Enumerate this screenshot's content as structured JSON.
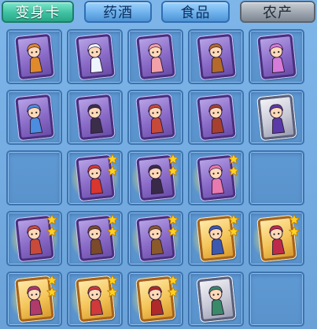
{
  "tabs": [
    {
      "label": "变身卡",
      "state": "active"
    },
    {
      "label": "药酒",
      "state": "inactive"
    },
    {
      "label": "食品",
      "state": "inactive"
    },
    {
      "label": "农产",
      "state": "gray"
    }
  ],
  "colors": {
    "background": "#6fa6dc",
    "slot": "#5a93cc",
    "card_purple": "#8a6bc8",
    "card_gold": "#f4c55a",
    "card_silver": "#c8c9d6",
    "star": "#ffd21f"
  },
  "grid": {
    "columns": 5,
    "rows": 5,
    "slots": [
      {
        "card": "purple",
        "icon": "monkey-king-card-icon",
        "stars": 0,
        "glow": false,
        "figure": "#e08a2a"
      },
      {
        "card": "purple",
        "icon": "white-horse-card-icon",
        "stars": 0,
        "glow": false,
        "figure": "#eef4ff"
      },
      {
        "card": "purple",
        "icon": "pig-card-icon",
        "stars": 0,
        "glow": false,
        "figure": "#f3a0a8"
      },
      {
        "card": "purple",
        "icon": "monk-card-icon",
        "stars": 0,
        "glow": false,
        "figure": "#b36a2a"
      },
      {
        "card": "purple",
        "icon": "fairy-fox-card-icon",
        "stars": 0,
        "glow": false,
        "figure": "#d67bd8"
      },
      {
        "card": "purple",
        "icon": "blue-beast-card-icon",
        "stars": 0,
        "glow": false,
        "figure": "#4b8de0"
      },
      {
        "card": "purple",
        "icon": "dark-warrior-card-icon",
        "stars": 0,
        "glow": false,
        "figure": "#3a2e4a"
      },
      {
        "card": "purple",
        "icon": "red-demon-card-icon",
        "stars": 0,
        "glow": false,
        "figure": "#c6493a"
      },
      {
        "card": "purple",
        "icon": "armored-demon-card-icon",
        "stars": 0,
        "glow": false,
        "figure": "#a8402f"
      },
      {
        "card": "silver",
        "icon": "purple-knight-card-icon",
        "stars": 0,
        "glow": false,
        "figure": "#5a3aa8"
      },
      {
        "card": null,
        "icon": "",
        "stars": 0,
        "glow": false,
        "figure": ""
      },
      {
        "card": "purple",
        "icon": "red-phoenix-card-icon",
        "stars": 2,
        "glow": true,
        "figure": "#d8362e"
      },
      {
        "card": "purple",
        "icon": "dark-maiden-card-icon",
        "stars": 2,
        "glow": true,
        "figure": "#3a2a4a"
      },
      {
        "card": "purple",
        "icon": "pink-maiden-card-icon",
        "stars": 2,
        "glow": true,
        "figure": "#e87ab0"
      },
      {
        "card": null,
        "icon": "",
        "stars": 0,
        "glow": false,
        "figure": ""
      },
      {
        "card": "purple",
        "icon": "red-ogre-card-icon",
        "stars": 2,
        "glow": true,
        "figure": "#c84a3a"
      },
      {
        "card": "purple",
        "icon": "horned-king-card-icon",
        "stars": 2,
        "glow": true,
        "figure": "#7a4a2a"
      },
      {
        "card": "purple",
        "icon": "gold-warrior-card-icon",
        "stars": 2,
        "glow": true,
        "figure": "#8a5a2a"
      },
      {
        "card": "gold",
        "icon": "fairy-princess-card-icon",
        "stars": 2,
        "glow": true,
        "figure": "#3a5ab0"
      },
      {
        "card": "gold",
        "icon": "wing-fairy-card-icon",
        "stars": 2,
        "glow": true,
        "figure": "#c02a4a"
      },
      {
        "card": "gold",
        "icon": "goddess-card-icon",
        "stars": 2,
        "glow": true,
        "figure": "#b03a6a"
      },
      {
        "card": "gold",
        "icon": "red-dancer-card-icon",
        "stars": 2,
        "glow": true,
        "figure": "#d03a3a"
      },
      {
        "card": "gold",
        "icon": "crimson-immortal-card-icon",
        "stars": 2,
        "glow": true,
        "figure": "#b02a2a"
      },
      {
        "card": "silver",
        "icon": "jade-warrior-card-icon",
        "stars": 0,
        "glow": false,
        "figure": "#3a8a6a"
      },
      {
        "card": null,
        "icon": "",
        "stars": 0,
        "glow": false,
        "figure": ""
      }
    ]
  }
}
